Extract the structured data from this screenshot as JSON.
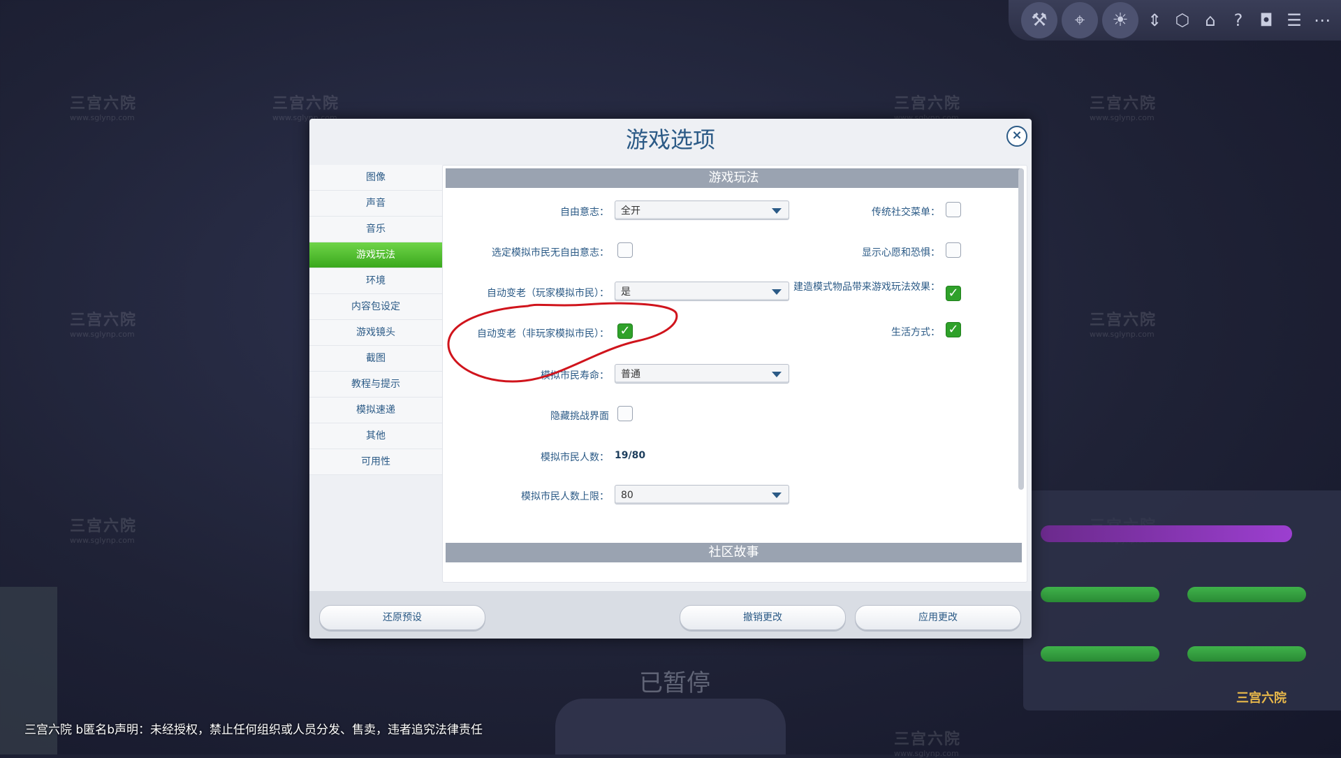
{
  "dialog": {
    "title": "游戏选项"
  },
  "tabs": [
    {
      "label": "图像",
      "active": false
    },
    {
      "label": "声音",
      "active": false
    },
    {
      "label": "音乐",
      "active": false
    },
    {
      "label": "游戏玩法",
      "active": true
    },
    {
      "label": "环境",
      "active": false
    },
    {
      "label": "内容包设定",
      "active": false
    },
    {
      "label": "游戏镜头",
      "active": false
    },
    {
      "label": "截图",
      "active": false
    },
    {
      "label": "教程与提示",
      "active": false
    },
    {
      "label": "模拟速递",
      "active": false
    },
    {
      "label": "其他",
      "active": false
    },
    {
      "label": "可用性",
      "active": false
    }
  ],
  "gameplay": {
    "section_title": "游戏玩法",
    "free_will": {
      "label": "自由意志：",
      "value": "全开"
    },
    "selected_sim_no_free_will": {
      "label": "选定模拟市民无自由意志：",
      "checked": false
    },
    "auto_age_played": {
      "label": "自动变老（玩家模拟市民）：",
      "value": "是"
    },
    "auto_age_unplayed": {
      "label": "自动变老（非玩家模拟市民）：",
      "checked": true
    },
    "sim_lifespan": {
      "label": "模拟市民寿命：",
      "value": "普通"
    },
    "hide_challenge_ui": {
      "label": "隐藏挑战界面",
      "checked": false
    },
    "sim_count": {
      "label": "模拟市民人数：",
      "value": "19/80"
    },
    "sim_limit": {
      "label": "模拟市民人数上限：",
      "value": "80"
    },
    "classic_social_menu": {
      "label": "传统社交菜单：",
      "checked": false
    },
    "show_wants_fears": {
      "label": "显示心愿和恐惧：",
      "checked": false
    },
    "build_mode_gameplay": {
      "label": "建造模式物品带来游戏玩法效果：",
      "checked": true
    },
    "lifestyles": {
      "label": "生活方式：",
      "checked": true
    }
  },
  "community": {
    "section_title": "社区故事"
  },
  "footer": {
    "restore_defaults": "还原预设",
    "undo_changes": "撤销更改",
    "apply_changes": "应用更改"
  },
  "overlay": {
    "paused": "已暂停",
    "disclaimer": "三宫六院 b匿名b声明：未经授权，禁止任何组织或人员分发、售卖，违者追究法律责任",
    "watermark_text": "三宫六院",
    "watermark_url": "www.sglynp.com"
  },
  "colors": {
    "accent_blue": "#2b5a86",
    "active_tab_green": "#3aa81d",
    "checkbox_green": "#2fa12a",
    "annotation_red": "#d0141c"
  },
  "icons": [
    "build-tools-icon",
    "map-icon",
    "lightbulb-icon",
    "arrows-icon",
    "cube-icon",
    "house-icon",
    "help-icon",
    "camera-icon",
    "list-icon",
    "more-icon"
  ]
}
